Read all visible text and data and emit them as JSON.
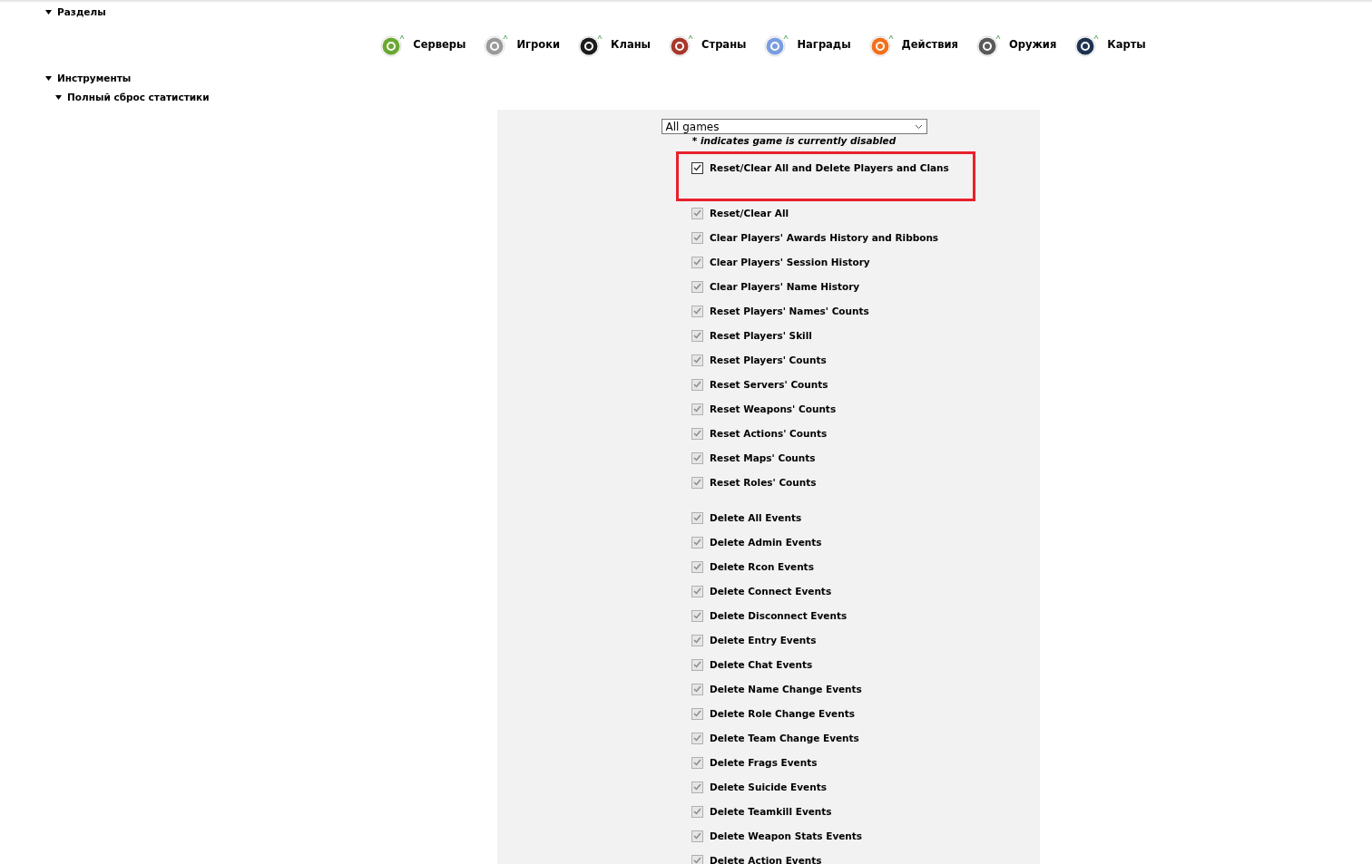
{
  "tree": [
    {
      "label": "Разделы",
      "expanded": true
    },
    {
      "label": "Инструменты",
      "expanded": true,
      "children": [
        {
          "label": "Полный сброс статистики",
          "expanded": true
        }
      ]
    }
  ],
  "nav": [
    {
      "label": "Серверы",
      "color": "#6aa832"
    },
    {
      "label": "Игроки",
      "color": "#9a9a9a"
    },
    {
      "label": "Кланы",
      "color": "#1c1c1c"
    },
    {
      "label": "Страны",
      "color": "#a8372c"
    },
    {
      "label": "Награды",
      "color": "#7a9de0"
    },
    {
      "label": "Действия",
      "color": "#f2701c"
    },
    {
      "label": "Оружия",
      "color": "#5a5a5a"
    },
    {
      "label": "Карты",
      "color": "#1e3350"
    }
  ],
  "game_select": {
    "value": "All games"
  },
  "note": "* indicates game is currently disabled",
  "option_groups": [
    {
      "highlighted": true,
      "options": [
        {
          "label": "Reset/Clear All and Delete Players and Clans",
          "checked": true,
          "disabled": false
        }
      ]
    },
    {
      "highlighted": false,
      "options": [
        {
          "label": "Reset/Clear All",
          "checked": true,
          "disabled": true
        },
        {
          "label": "Clear Players' Awards History and Ribbons",
          "checked": true,
          "disabled": true
        },
        {
          "label": "Clear Players' Session History",
          "checked": true,
          "disabled": true
        },
        {
          "label": "Clear Players' Name History",
          "checked": true,
          "disabled": true
        },
        {
          "label": "Reset Players' Names' Counts",
          "checked": true,
          "disabled": true
        },
        {
          "label": "Reset Players' Skill",
          "checked": true,
          "disabled": true
        },
        {
          "label": "Reset Players' Counts",
          "checked": true,
          "disabled": true
        },
        {
          "label": "Reset Servers' Counts",
          "checked": true,
          "disabled": true
        },
        {
          "label": "Reset Weapons' Counts",
          "checked": true,
          "disabled": true
        },
        {
          "label": "Reset Actions' Counts",
          "checked": true,
          "disabled": true
        },
        {
          "label": "Reset Maps' Counts",
          "checked": true,
          "disabled": true
        },
        {
          "label": "Reset Roles' Counts",
          "checked": true,
          "disabled": true
        }
      ]
    },
    {
      "highlighted": false,
      "options": [
        {
          "label": "Delete All Events",
          "checked": true,
          "disabled": true
        },
        {
          "label": "Delete Admin Events",
          "checked": true,
          "disabled": true
        },
        {
          "label": "Delete Rcon Events",
          "checked": true,
          "disabled": true
        },
        {
          "label": "Delete Connect Events",
          "checked": true,
          "disabled": true
        },
        {
          "label": "Delete Disconnect Events",
          "checked": true,
          "disabled": true
        },
        {
          "label": "Delete Entry Events",
          "checked": true,
          "disabled": true
        },
        {
          "label": "Delete Chat Events",
          "checked": true,
          "disabled": true
        },
        {
          "label": "Delete Name Change Events",
          "checked": true,
          "disabled": true
        },
        {
          "label": "Delete Role Change Events",
          "checked": true,
          "disabled": true
        },
        {
          "label": "Delete Team Change Events",
          "checked": true,
          "disabled": true
        },
        {
          "label": "Delete Frags Events",
          "checked": true,
          "disabled": true
        },
        {
          "label": "Delete Suicide Events",
          "checked": true,
          "disabled": true
        },
        {
          "label": "Delete Teamkill Events",
          "checked": true,
          "disabled": true
        },
        {
          "label": "Delete Weapon Stats Events",
          "checked": true,
          "disabled": true
        },
        {
          "label": "Delete Action Events",
          "checked": true,
          "disabled": true
        }
      ]
    }
  ]
}
